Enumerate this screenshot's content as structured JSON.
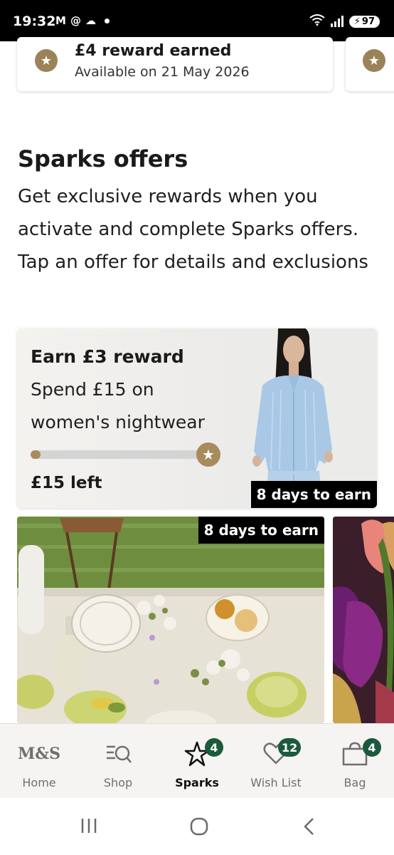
{
  "status_bar": {
    "time": "19:32",
    "battery": "97",
    "left_icons": [
      "gmail-icon",
      "threads-icon",
      "weather-icon",
      "dot-icon"
    ],
    "right_icons": [
      "wifi-icon",
      "signal-icon",
      "battery-icon"
    ]
  },
  "rewards": {
    "main": {
      "title": "£4 reward earned",
      "subtitle": "Available on 21 May 2026",
      "icon": "star-icon"
    },
    "peek": {
      "icon": "star-icon"
    }
  },
  "sparks_offers": {
    "title": "Sparks offers",
    "description": "Get exclusive rewards when you activate and complete Sparks offers. Tap an offer for details and exclusions"
  },
  "offer_card": {
    "title": "Earn £3 reward",
    "line1": "Spend £15 on",
    "line2": "women's nightwear",
    "progress": 0.05,
    "amount_left": "£15 left",
    "days_badge": "8 days to earn",
    "accent": "#a88b5c"
  },
  "photo_cards": [
    {
      "days_badge": "8 days to earn",
      "image": "table-setting-photo"
    },
    {
      "image": "tulips-photo"
    }
  ],
  "bottom_nav": {
    "items": [
      {
        "label": "Home",
        "icon": "ms-logo-icon",
        "logo_text": "M&S",
        "badge": ""
      },
      {
        "label": "Shop",
        "icon": "shop-search-icon",
        "badge": ""
      },
      {
        "label": "Sparks",
        "icon": "sparks-star-icon",
        "badge": "4",
        "active": true
      },
      {
        "label": "Wish List",
        "icon": "heart-icon",
        "badge": "12"
      },
      {
        "label": "Bag",
        "icon": "bag-icon",
        "badge": "4"
      }
    ],
    "badge_color": "#1c5a3c"
  },
  "system_nav": [
    "recents-icon",
    "home-circle-icon",
    "back-icon"
  ]
}
